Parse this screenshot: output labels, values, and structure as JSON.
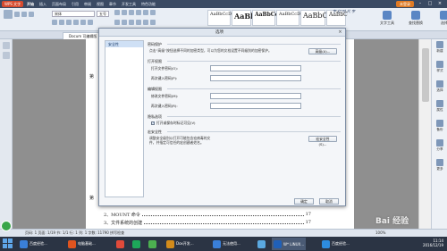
{
  "titlebar": {
    "app_name": "WPS 文字",
    "menu": [
      "开始",
      "插入",
      "页面布局",
      "引用",
      "审阅",
      "视图",
      "章节",
      "开发工具",
      "特色功能"
    ],
    "active_menu": "开始",
    "account_button": "未登录"
  },
  "ribbon": {
    "font_name": "宋体",
    "font_size": "五号",
    "styles": [
      "AaBbCcDd",
      "AaBl",
      "AaBbCcDd",
      "AaBbCcDd",
      "AaBbCc",
      "AaBbC"
    ],
    "watermark": "字 幻 时 代 字",
    "right_buttons": [
      "文字工具",
      "查找替换",
      "选择"
    ]
  },
  "tabbar": {
    "doc_tab": "Docum 可编辑版"
  },
  "page": {
    "marker_1": "第",
    "marker_2": "第",
    "toc": [
      {
        "label": "2、MOUNT 命令",
        "page": "17"
      },
      {
        "label": "3、文件系统的创建",
        "page": "17"
      }
    ]
  },
  "right_panel": {
    "items": [
      "新建",
      "样式",
      "选择",
      "属性",
      "备份",
      "分享",
      "更多"
    ]
  },
  "statusbar": {
    "left": "页码: 1  页面: 1/19  节: 1/1  行: 1  列: 1  字数: 11790  拼写检查",
    "right": "100%"
  },
  "dialog": {
    "title": "选项",
    "nav_items": [
      "安全性"
    ],
    "sections": {
      "password_protection": {
        "title": "密码保护",
        "description": "点击“高级”按钮选择不同的加密类型，可以为您的文档设置不同级别的加密保护。",
        "advanced_button": "高级(A)..."
      },
      "open_permission": {
        "title": "打开权限",
        "fields": [
          {
            "label": "打开文件密码(O):",
            "value": ""
          },
          {
            "label": "再次键入密码(P):",
            "value": ""
          }
        ]
      },
      "edit_permission": {
        "title": "编辑权限",
        "fields": [
          {
            "label": "修改文件密码(M):",
            "value": ""
          },
          {
            "label": "再次键入密码(R):",
            "value": ""
          }
        ]
      },
      "privacy": {
        "title": "隐私选项",
        "checkbox_label": "打开或保存时标记可见(V)",
        "checked": true
      },
      "macro_security": {
        "title": "宏安全性",
        "description_line1": "调整安全级别以打开可能包含宏病毒的文",
        "description_line2": "件，并指定可信任的宏创建者姓名。",
        "button": "宏安全性(S)..."
      }
    },
    "ok": "确定",
    "cancel": "取消"
  },
  "taskbar": {
    "tasks": [
      {
        "label": "百度经验...",
        "color": "#3a7fd8"
      },
      {
        "label": "电脑基础...",
        "color": "#e0541f"
      },
      {
        "label": "",
        "color": "#e14a3a"
      },
      {
        "label": "",
        "color": "#1da85a"
      },
      {
        "label": "",
        "color": "#4caf50"
      },
      {
        "label": "Dox开发...",
        "color": "#d38b1a"
      },
      {
        "label": "无法使用...",
        "color": "#3a7fd8"
      },
      {
        "label": "",
        "color": "#5aa8e0"
      },
      {
        "label": "W* LINUX...",
        "color": "#2060b8"
      },
      {
        "label": "百度经验...",
        "color": "#2d8cdf"
      }
    ],
    "time": "11:14",
    "date": "2016/12/19"
  },
  "watermark": "Bai 经验"
}
